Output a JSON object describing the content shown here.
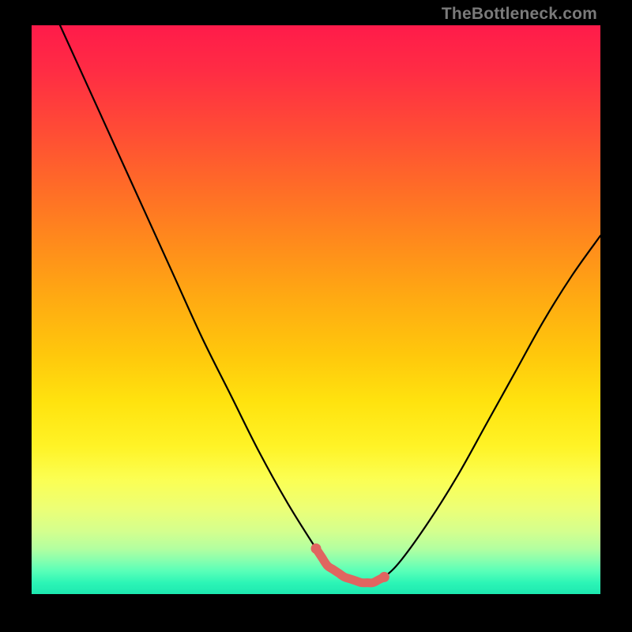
{
  "watermark": "TheBottleneck.com",
  "chart_data": {
    "type": "line",
    "title": "",
    "xlabel": "",
    "ylabel": "",
    "xlim": [
      0,
      100
    ],
    "ylim": [
      0,
      100
    ],
    "series": [
      {
        "name": "curve",
        "x": [
          5,
          10,
          15,
          20,
          25,
          30,
          35,
          40,
          45,
          50,
          52,
          55,
          58,
          60,
          62,
          65,
          70,
          75,
          80,
          85,
          90,
          95,
          100
        ],
        "y": [
          100,
          89,
          78,
          67,
          56,
          45,
          35,
          25,
          16,
          8,
          5,
          3,
          2,
          2,
          3,
          6,
          13,
          21,
          30,
          39,
          48,
          56,
          63
        ]
      }
    ],
    "highlight_range_x": [
      50,
      62
    ],
    "colors": {
      "curve": "#000000",
      "highlight": "#e06560",
      "gradient_top": "#ff1b4a",
      "gradient_bottom": "#1de8b0"
    }
  }
}
